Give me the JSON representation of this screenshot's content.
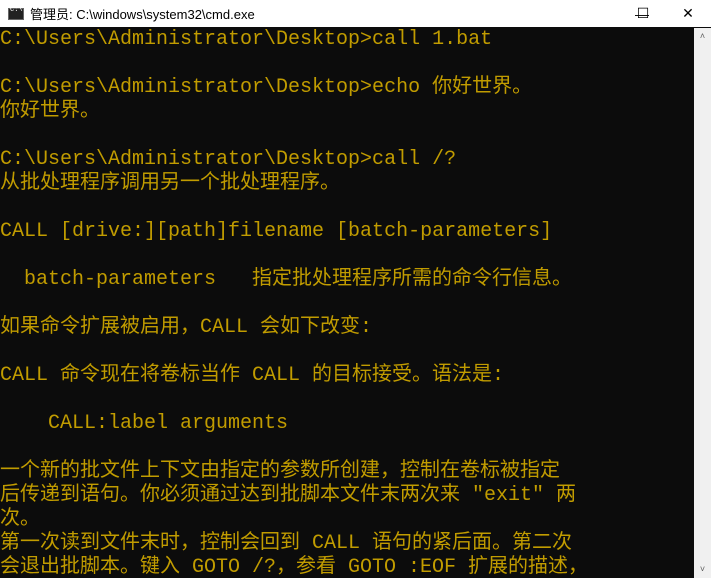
{
  "window": {
    "title": "管理员: C:\\windows\\system32\\cmd.exe",
    "minimize": "—",
    "maximize": "☐",
    "close": "✕"
  },
  "console_lines": [
    "C:\\Users\\Administrator\\Desktop>call 1.bat",
    "",
    "C:\\Users\\Administrator\\Desktop>echo 你好世界。",
    "你好世界。",
    "",
    "C:\\Users\\Administrator\\Desktop>call /?",
    "从批处理程序调用另一个批处理程序。",
    "",
    "CALL [drive:][path]filename [batch-parameters]",
    "",
    "  batch-parameters   指定批处理程序所需的命令行信息。",
    "",
    "如果命令扩展被启用，CALL 会如下改变:",
    "",
    "CALL 命令现在将卷标当作 CALL 的目标接受。语法是:",
    "",
    "    CALL:label arguments",
    "",
    "一个新的批文件上下文由指定的参数所创建，控制在卷标被指定",
    "后传递到语句。你必须通过达到批脚本文件末两次来 \"exit\" 两",
    "次。",
    "第一次读到文件末时，控制会回到 CALL 语句的紧后面。第二次",
    "会退出批脚本。键入 GOTO /?，参看 GOTO :EOF 扩展的描述，"
  ],
  "scrollbar": {
    "up": "˄",
    "down": "˅"
  }
}
